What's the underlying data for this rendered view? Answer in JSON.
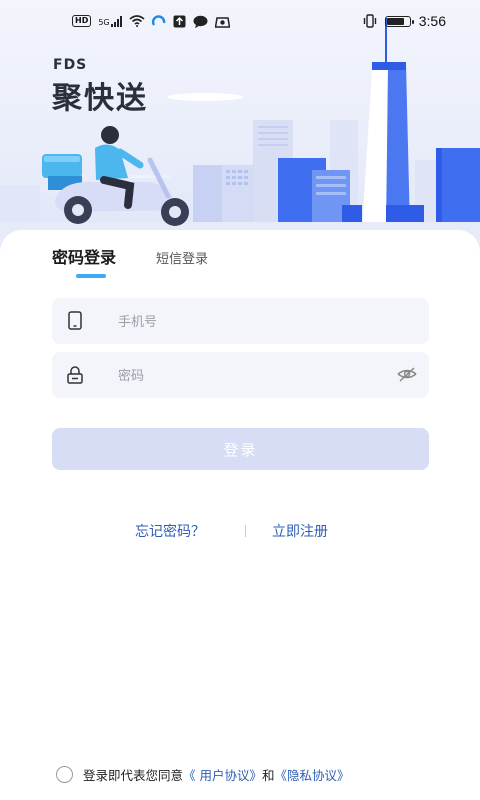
{
  "status_bar": {
    "network_label": "HD",
    "signal_label": "5G",
    "time": "3:56",
    "battery_level": 0.85,
    "icons": [
      "wifi-icon",
      "app-notification-icon",
      "upload-icon",
      "chat-icon",
      "app-icon",
      "vibrate-icon",
      "battery-icon"
    ]
  },
  "brand": {
    "logo_small": "FDS",
    "logo_name": "聚快送"
  },
  "tabs": {
    "password_login": "密码登录",
    "sms_login": "短信登录",
    "active": "password_login"
  },
  "form": {
    "phone_placeholder": "手机号",
    "password_placeholder": "密码",
    "login_button": "登录"
  },
  "links": {
    "forgot_password": "忘记密码？",
    "register": "立即注册"
  },
  "agreement": {
    "prefix": "登录即代表您同意",
    "user_agreement": "《 用户协议》",
    "and": "和",
    "privacy_policy": "《隐私协议》"
  },
  "colors": {
    "accent": "#3fa9f5",
    "link": "#2d5eb5",
    "button_disabled": "#d6ddf4",
    "input_bg": "#f3f5fb",
    "building_blue": "#3f6ef0"
  }
}
